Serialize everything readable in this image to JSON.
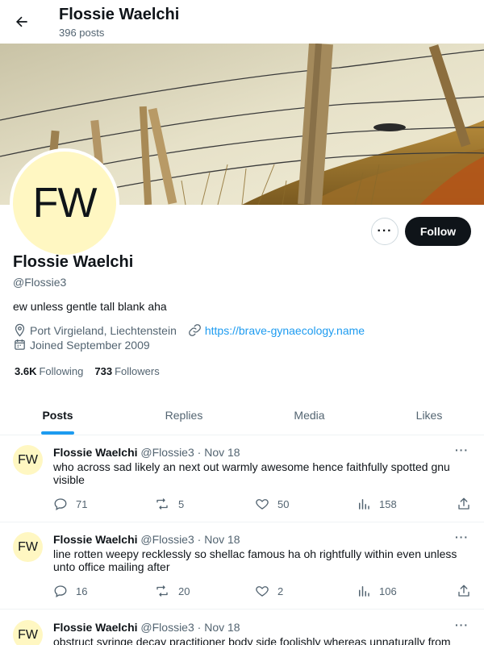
{
  "header": {
    "name": "Flossie Waelchi",
    "post_count": "396 posts"
  },
  "profile": {
    "avatar_initials": "FW",
    "name": "Flossie Waelchi",
    "handle": "@Flossie3",
    "bio": "ew unless gentle tall blank aha",
    "location": "Port Virgieland, Liechtenstein",
    "website": "https://brave-gynaecology.name",
    "joined": "Joined September 2009",
    "following_count": "3.6K",
    "following_label": "Following",
    "followers_count": "733",
    "followers_label": "Followers",
    "more_label": "···",
    "follow_label": "Follow"
  },
  "tabs": [
    {
      "label": "Posts",
      "active": true
    },
    {
      "label": "Replies",
      "active": false
    },
    {
      "label": "Media",
      "active": false
    },
    {
      "label": "Likes",
      "active": false
    }
  ],
  "posts": [
    {
      "avatar": "FW",
      "author": "Flossie Waelchi",
      "handle": "@Flossie3",
      "dot": "·",
      "date": "Nov 18",
      "more": "···",
      "text": "who across sad likely an next out warmly awesome hence faithfully spotted gnu visible",
      "replies": "71",
      "reposts": "5",
      "likes": "50",
      "views": "158"
    },
    {
      "avatar": "FW",
      "author": "Flossie Waelchi",
      "handle": "@Flossie3",
      "dot": "·",
      "date": "Nov 18",
      "more": "···",
      "text": "line rotten weepy recklessly so shellac famous ha oh rightfully within even unless unto office mailing after",
      "replies": "16",
      "reposts": "20",
      "likes": "2",
      "views": "106"
    },
    {
      "avatar": "FW",
      "author": "Flossie Waelchi",
      "handle": "@Flossie3",
      "dot": "·",
      "date": "Nov 18",
      "more": "···",
      "text": "obstruct syringe decay practitioner body side foolishly whereas unnaturally from",
      "replies": "",
      "reposts": "",
      "likes": "",
      "views": ""
    }
  ],
  "colors": {
    "accent": "#1d9bf0",
    "text": "#0f1419",
    "muted": "#536471",
    "avatar_bg": "#fff7c2"
  }
}
